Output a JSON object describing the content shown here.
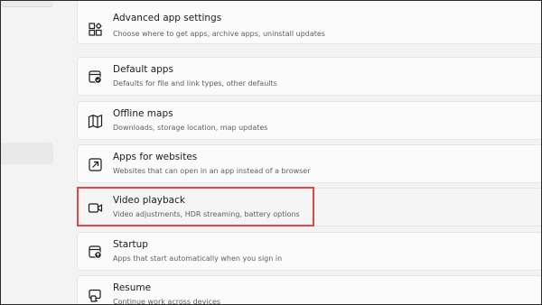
{
  "settings": [
    {
      "title": "Advanced app settings",
      "subtitle": "Choose where to get apps, archive apps, uninstall updates",
      "icon": "advanced-app-settings-icon"
    },
    {
      "title": "Default apps",
      "subtitle": "Defaults for file and link types, other defaults",
      "icon": "default-apps-icon"
    },
    {
      "title": "Offline maps",
      "subtitle": "Downloads, storage location, map updates",
      "icon": "map-icon"
    },
    {
      "title": "Apps for websites",
      "subtitle": "Websites that can open in an app instead of a browser",
      "icon": "open-in-app-icon"
    },
    {
      "title": "Video playback",
      "subtitle": "Video adjustments, HDR streaming, battery options",
      "icon": "video-camera-icon",
      "highlighted": true
    },
    {
      "title": "Startup",
      "subtitle": "Apps that start automatically when you sign in",
      "icon": "startup-icon"
    },
    {
      "title": "Resume",
      "subtitle": "Continue work across devices",
      "icon": "resume-icon"
    }
  ],
  "colors": {
    "highlight": "#e04848",
    "card_background": "#fbfbfb",
    "page_background": "#f3f3f3"
  }
}
